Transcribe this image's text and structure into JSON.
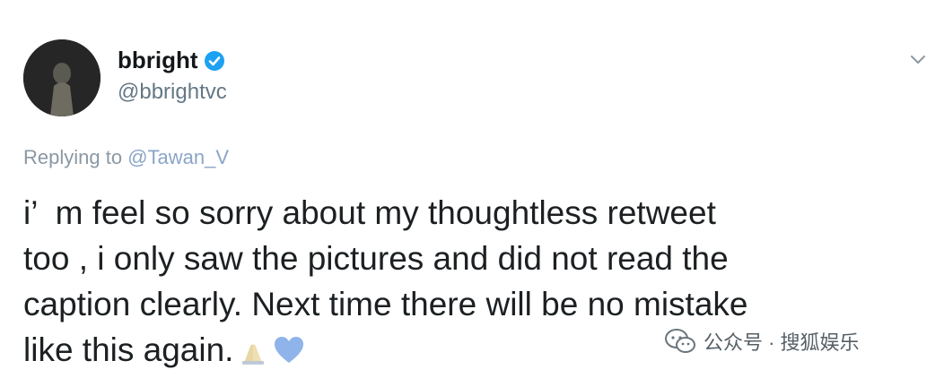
{
  "tweet": {
    "display_name": "bbright",
    "handle": "@bbrightvc",
    "replying_prefix": "Replying to ",
    "replying_to": "@Tawan_V",
    "body_lines": [
      "i’  m feel so sorry about my thoughtless retweet",
      "too , i only saw the pictures and did not read the",
      "caption clearly. Next time there will be no mistake",
      "like this again."
    ],
    "emojis": [
      "folded-hands-icon",
      "blue-heart-icon"
    ],
    "verified_color": "#1da1f2",
    "heart_color": "#8fb4ea"
  },
  "watermark": {
    "text": "公众号 · 搜狐娱乐",
    "icon": "wechat-icon"
  }
}
